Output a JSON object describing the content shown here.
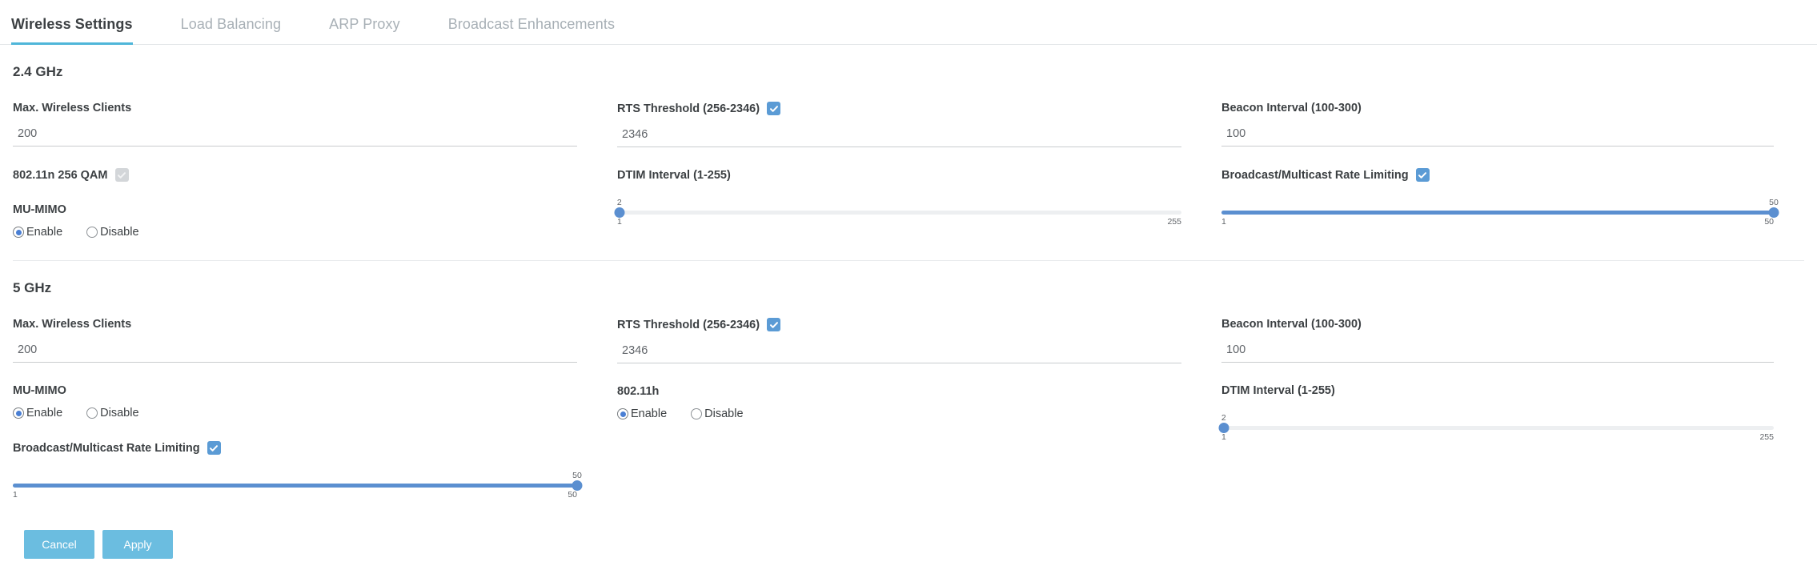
{
  "tabs": [
    {
      "label": "Wireless Settings",
      "active": true
    },
    {
      "label": "Load Balancing",
      "active": false
    },
    {
      "label": "ARP Proxy",
      "active": false
    },
    {
      "label": "Broadcast Enhancements",
      "active": false
    }
  ],
  "colors": {
    "accent": "#4fb6d9",
    "checkbox_on": "#5b9bd5",
    "checkbox_off": "#d3d6d9",
    "slider": "#5b8fd0",
    "button": "#6bbde0"
  },
  "sections": [
    {
      "title": "2.4 GHz",
      "max_clients": {
        "label": "Max. Wireless Clients",
        "value": "200"
      },
      "qam": {
        "label": "802.11n 256 QAM",
        "checked": true,
        "disabled": true
      },
      "mu_mimo": {
        "label": "MU-MIMO",
        "options": [
          "Enable",
          "Disable"
        ],
        "selected": "Enable"
      },
      "rts": {
        "label": "RTS Threshold (256-2346)",
        "checked": true,
        "value": "2346"
      },
      "dtim": {
        "label": "DTIM Interval (1-255)",
        "value": "2",
        "min": "1",
        "max": "255"
      },
      "beacon": {
        "label": "Beacon Interval (100-300)",
        "value": "100"
      },
      "rate_limit": {
        "label": "Broadcast/Multicast Rate Limiting",
        "checked": true,
        "value": "50",
        "min": "1",
        "max": "50"
      }
    },
    {
      "title": "5 GHz",
      "max_clients": {
        "label": "Max. Wireless Clients",
        "value": "200"
      },
      "mu_mimo": {
        "label": "MU-MIMO",
        "options": [
          "Enable",
          "Disable"
        ],
        "selected": "Enable"
      },
      "rate_limit": {
        "label": "Broadcast/Multicast Rate Limiting",
        "checked": true,
        "value": "50",
        "min": "1",
        "max": "50"
      },
      "rts": {
        "label": "RTS Threshold (256-2346)",
        "checked": true,
        "value": "2346"
      },
      "dot11h": {
        "label": "802.11h",
        "options": [
          "Enable",
          "Disable"
        ],
        "selected": "Enable"
      },
      "beacon": {
        "label": "Beacon Interval (100-300)",
        "value": "100"
      },
      "dtim": {
        "label": "DTIM Interval (1-255)",
        "value": "2",
        "min": "1",
        "max": "255"
      }
    }
  ],
  "footer": {
    "cancel_label": "Cancel",
    "apply_label": "Apply"
  }
}
